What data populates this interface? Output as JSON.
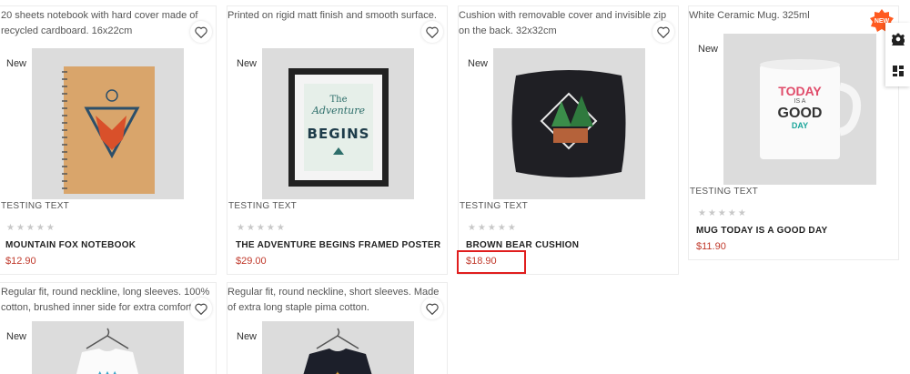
{
  "products": [
    {
      "description": "20 sheets notebook with hard cover made of recycled cardboard. 16x22cm",
      "new_label": "New",
      "category": "TESTING TEXT",
      "stars": "★★★★★",
      "title": "MOUNTAIN FOX NOTEBOOK",
      "price": "$12.90"
    },
    {
      "description": "Printed on rigid matt finish and smooth surface.",
      "new_label": "New",
      "poster_line1": "The",
      "poster_line2": "Adventure",
      "poster_line3": "BEGINS",
      "category": "TESTING TEXT",
      "stars": "★★★★★",
      "title": "THE ADVENTURE BEGINS FRAMED POSTER",
      "price": "$29.00"
    },
    {
      "description": "Cushion with removable cover and invisible zip on the back. 32x32cm",
      "new_label": "New",
      "category": "TESTING TEXT",
      "stars": "★★★★★",
      "title": "BROWN BEAR CUSHION",
      "price": "$18.90"
    },
    {
      "description": "White Ceramic Mug. 325ml",
      "new_label": "New",
      "mug_line1": "TODAY",
      "mug_line2": "IS A",
      "mug_line3": "GOOD",
      "mug_line4": "DAY",
      "category": "TESTING TEXT",
      "stars": "★★★★★",
      "title": "MUG TODAY IS A GOOD DAY",
      "price": "$11.90"
    },
    {
      "description": "Regular fit, round neckline, long sleeves. 100% cotton, brushed inner side for extra comfort.",
      "new_label": "New"
    },
    {
      "description": "Regular fit, round neckline, short sleeves. Made of extra long staple pima cotton.",
      "new_label": "New"
    }
  ],
  "corner_badge": "NEW",
  "colors": {
    "price": "#c0392b",
    "highlight": "#e01e1e",
    "badge": "#ff5a1f"
  },
  "icons": [
    "heart-icon",
    "gear-icon",
    "layout-icon"
  ]
}
